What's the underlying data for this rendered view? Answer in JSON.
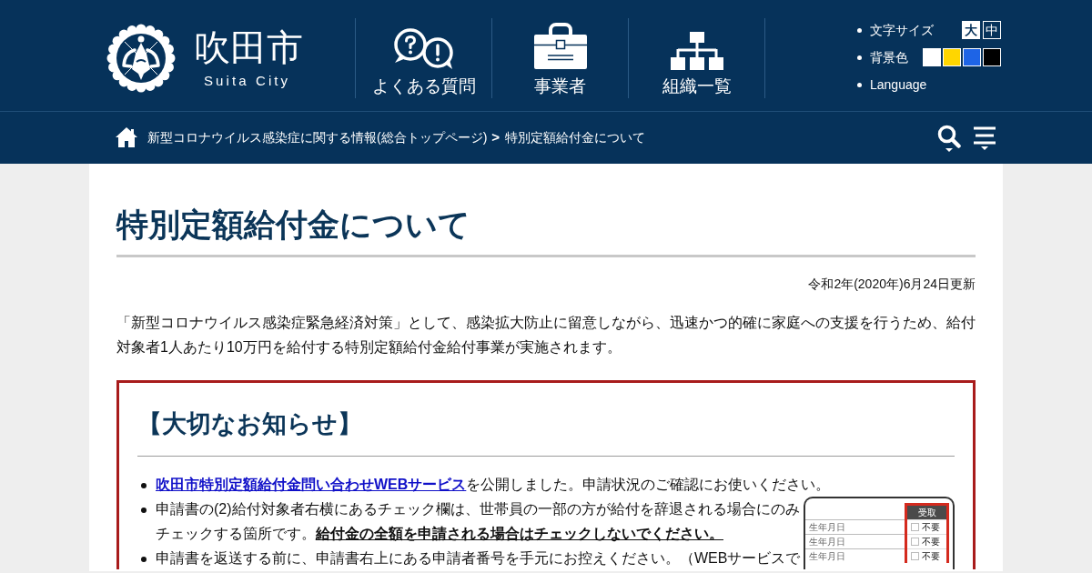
{
  "header": {
    "logo": {
      "name": "吹田市",
      "subtitle": "Suita City"
    },
    "nav": [
      {
        "label": "よくある質問",
        "kind": "faq"
      },
      {
        "label": "事業者",
        "kind": "business"
      },
      {
        "label": "組織一覧",
        "kind": "organization"
      }
    ],
    "tools": {
      "text_size": {
        "label": "文字サイズ",
        "options": [
          {
            "label": "大",
            "selected": false
          },
          {
            "label": "中",
            "selected": true
          }
        ]
      },
      "background": {
        "label": "背景色",
        "swatches": [
          {
            "color": "#ffffff"
          },
          {
            "color": "#ffd600"
          },
          {
            "color": "#1e64e6"
          },
          {
            "color": "#000000"
          }
        ]
      },
      "language": {
        "label": "Language"
      }
    }
  },
  "breadcrumb": [
    {
      "label": "新型コロナウイルス感染症に関する情報(総合トップページ)",
      "kind": "link"
    },
    {
      "label": ">",
      "kind": "separator"
    },
    {
      "label": "特別定額給付金について",
      "kind": "current"
    }
  ],
  "page": {
    "title": "特別定額給付金について",
    "updated": "令和2年(2020年)6月24日更新",
    "intro": "「新型コロナウイルス感染症緊急経済対策」として、感染拡大防止に留意しながら、迅速かつ的確に家庭への支援を行うため、給付対象者1人あたり10万円を給付する特別定額給付金給付事業が実施されます。",
    "notice": {
      "title": "【大切なお知らせ】",
      "items": [
        {
          "link": "吹田市特別定額給付金問い合わせWEBサービス",
          "text": "を公開しました。申請状況のご確認にお使いください。"
        },
        {
          "text": "申請書の(2)給付対象者右横にあるチェック欄は、世帯員の一部の方が給付を辞退される場合にのみチェックする箇所です。**給付金の全額を申請される場合はチェックしないでください。**",
          "form_sample": {
            "header": "受取",
            "rows": [
              {
                "label": "生年月日",
                "option": "不要",
                "checked": false
              },
              {
                "label": "生年月日",
                "option": "不要",
                "checked": false
              },
              {
                "label": "生年月日",
                "option": "不要",
                "checked": false
              }
            ]
          }
        },
        {
          "text": "申請書を返送する前に、申請書右上にある申請者番号を手元にお控えください。（WEBサービスで"
        }
      ]
    }
  }
}
